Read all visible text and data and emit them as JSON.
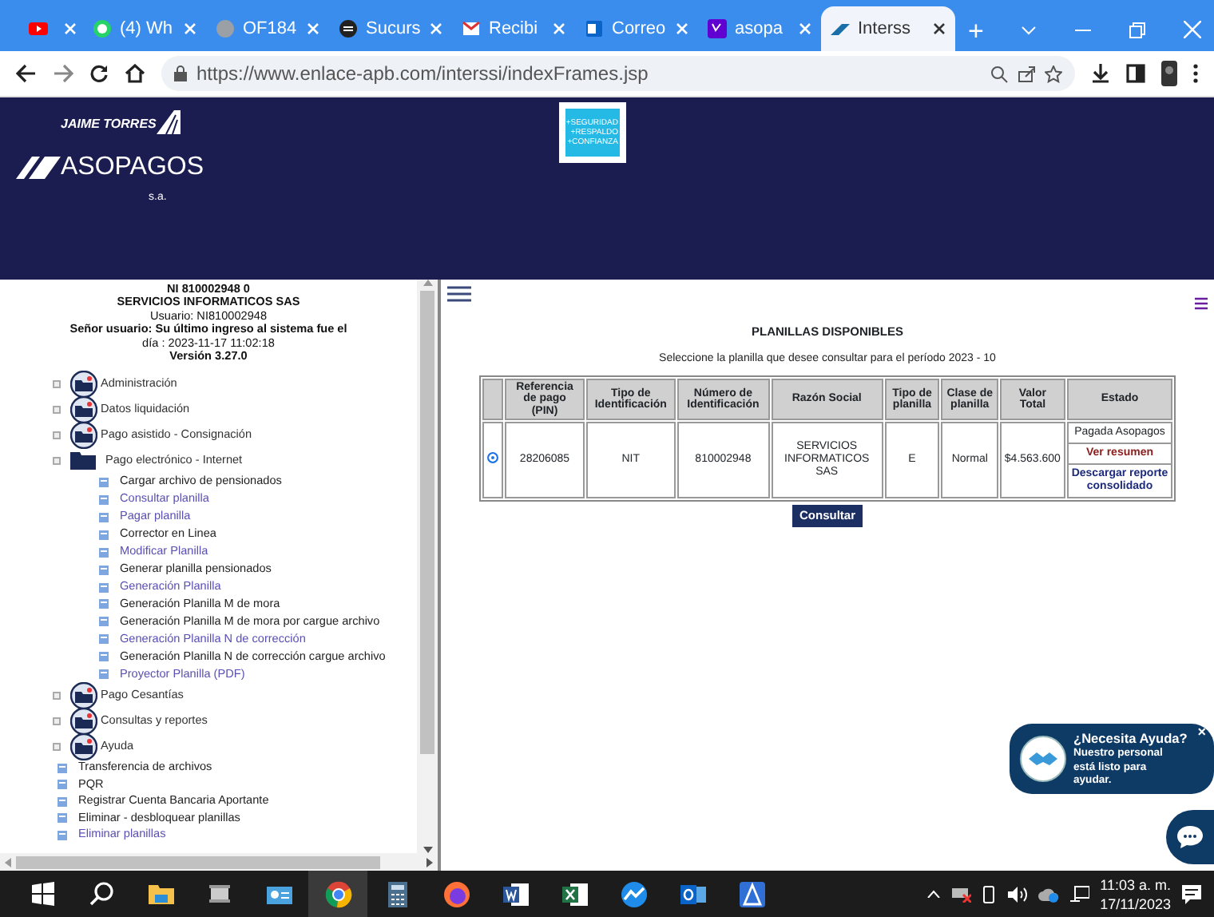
{
  "browser": {
    "tabs": [
      {
        "selected": false
      },
      {
        "label": "(4) Wh",
        "selected": false
      },
      {
        "label": "OF184",
        "selected": false
      },
      {
        "label": "Sucurs",
        "selected": false
      },
      {
        "label": "Recibi",
        "selected": false
      },
      {
        "label": "Correo",
        "selected": false
      },
      {
        "label": "asopa",
        "selected": false
      },
      {
        "label": "Interss",
        "selected": true
      }
    ],
    "new_tab": "+",
    "url": "https://www.enlace-apb.com/interssi/indexFrames.jsp"
  },
  "header": {
    "logo_top": "JAIME TORRES",
    "logo_main": "ASOPAGOS",
    "logo_suffix": "s.a.",
    "badge_lines": [
      "+SEGURIDAD",
      "+RESPALDO",
      "+CONFIANZA"
    ]
  },
  "sidebar": {
    "account_lines": [
      "NI 810002948 0",
      "SERVICIOS INFORMATICOS SAS",
      "Usuario: NI810002948",
      "Señor usuario: Su último ingreso al sistema fue el",
      "día : 2023-11-17 11:02:18",
      "Versión 3.27.0"
    ],
    "tree": [
      {
        "kind": "folder",
        "label": "Administración",
        "expanded": false
      },
      {
        "kind": "folder",
        "label": "Datos liquidación",
        "expanded": false
      },
      {
        "kind": "folder",
        "label": "Pago asistido - Consignación",
        "expanded": false
      },
      {
        "kind": "folder",
        "label": "Pago electrónico - Internet",
        "expanded": true,
        "children": [
          {
            "label": "Cargar archivo de pensionados",
            "visited": false
          },
          {
            "label": "Consultar planilla",
            "visited": true
          },
          {
            "label": "Pagar planilla",
            "visited": true
          },
          {
            "label": "Corrector en Linea",
            "visited": false
          },
          {
            "label": "Modificar Planilla",
            "visited": true
          },
          {
            "label": "Generar planilla pensionados",
            "visited": false
          },
          {
            "label": "Generación Planilla",
            "visited": true
          },
          {
            "label": "Generación Planilla M de mora",
            "visited": false
          },
          {
            "label": "Generación Planilla M de mora por cargue archivo",
            "visited": false
          },
          {
            "label": "Generación Planilla N de corrección",
            "visited": true
          },
          {
            "label": "Generación Planilla N de corrección cargue archivo",
            "visited": false
          },
          {
            "label": "Proyector Planilla (PDF)",
            "visited": true
          }
        ]
      },
      {
        "kind": "folder",
        "label": "Pago Cesantías",
        "expanded": false
      },
      {
        "kind": "folder",
        "label": "Consultas y reportes",
        "expanded": false
      },
      {
        "kind": "folder",
        "label": "Ayuda",
        "expanded": false
      },
      {
        "kind": "page",
        "label": "Transferencia de archivos",
        "visited": false
      },
      {
        "kind": "page",
        "label": "PQR",
        "visited": false
      },
      {
        "kind": "page",
        "label": "Registrar Cuenta Bancaria Aportante",
        "visited": false
      },
      {
        "kind": "page",
        "label": "Eliminar - desbloquear planillas",
        "visited": false
      },
      {
        "kind": "page",
        "label": "Eliminar planillas",
        "visited": true
      }
    ]
  },
  "content": {
    "title": "PLANILLAS DISPONIBLES",
    "subtitle": "Seleccione la planilla que desee consultar para el período 2023 - 10",
    "table": {
      "columns": [
        "Referencia de pago (PIN)",
        "Tipo de Identificación",
        "Número de Identificación",
        "Razón Social",
        "Tipo de planilla",
        "Clase de planilla",
        "Valor Total",
        "Estado"
      ],
      "rows": [
        {
          "selected": true,
          "cells": [
            "28206085",
            "NIT",
            "810002948",
            "SERVICIOS INFORMATICOS SAS",
            "E",
            "Normal",
            "$4.563.600"
          ],
          "estado": [
            {
              "kind": "text",
              "label": "Pagada Asopagos"
            },
            {
              "kind": "action",
              "label": "Ver resumen"
            },
            {
              "kind": "link",
              "label": "Descargar reporte consolidado"
            }
          ]
        }
      ]
    },
    "submit": "Consultar"
  },
  "chat": {
    "title": "¿Necesita Ayuda?",
    "message": "Nuestro personal está listo para ayudar.",
    "close": "×"
  },
  "taskbar": {
    "time": "11:03 a. m.",
    "date": "17/11/2023"
  }
}
